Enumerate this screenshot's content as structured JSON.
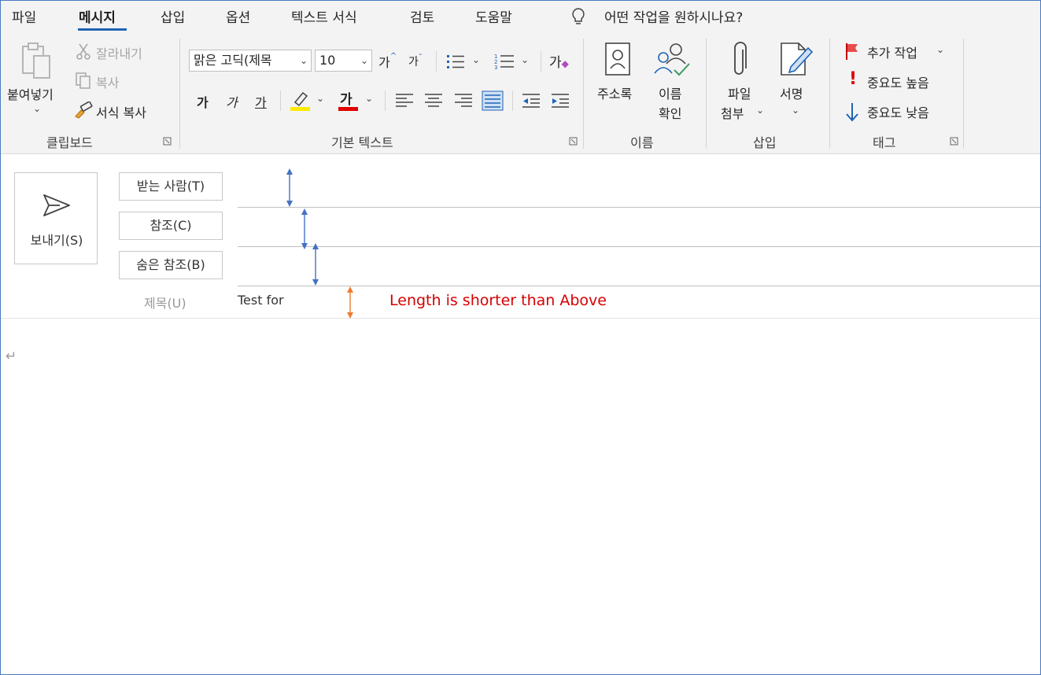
{
  "tabs": [
    "파일",
    "메시지",
    "삽입",
    "옵션",
    "텍스트 서식",
    "검토",
    "도움말"
  ],
  "active_tab": "메시지",
  "tell_me": "어떤 작업을 원하시나요?",
  "clipboard": {
    "paste": "붙여넣기",
    "cut": "잘라내기",
    "copy": "복사",
    "format_painter": "서식 복사",
    "group_label": "클립보드"
  },
  "basic_text": {
    "font_name": "맑은 고딕(제목",
    "font_size": "10",
    "grow_font": "가",
    "shrink_font": "가",
    "bold": "가",
    "italic": "가",
    "underline": "가",
    "font_color_glyph": "가",
    "clear_format": "가",
    "group_label": "기본 텍스트",
    "highlight_color": "#ffeb00",
    "font_color": "#e00000"
  },
  "names": {
    "address_book": "주소록",
    "check_names_line1": "이름",
    "check_names_line2": "확인",
    "group_label": "이름"
  },
  "insert": {
    "attach_line1": "파일",
    "attach_line2": "첨부",
    "signature": "서명",
    "group_label": "삽입"
  },
  "tags": {
    "follow_up": "추가 작업",
    "high_importance": "중요도 높음",
    "low_importance": "중요도 낮음",
    "group_label": "태그"
  },
  "compose": {
    "send": "보내기(S)",
    "to": "받는 사람(T)",
    "cc": "참조(C)",
    "bcc": "숨은 참조(B)",
    "subject_label": "제목(U)",
    "subject_value": "Test for"
  },
  "annotation": {
    "text": "Length is shorter than Above",
    "color": "#d60000"
  },
  "colors": {
    "accent": "#1f64b4",
    "blue_arrow": "#4472c4",
    "orange_arrow": "#ed7d31"
  }
}
